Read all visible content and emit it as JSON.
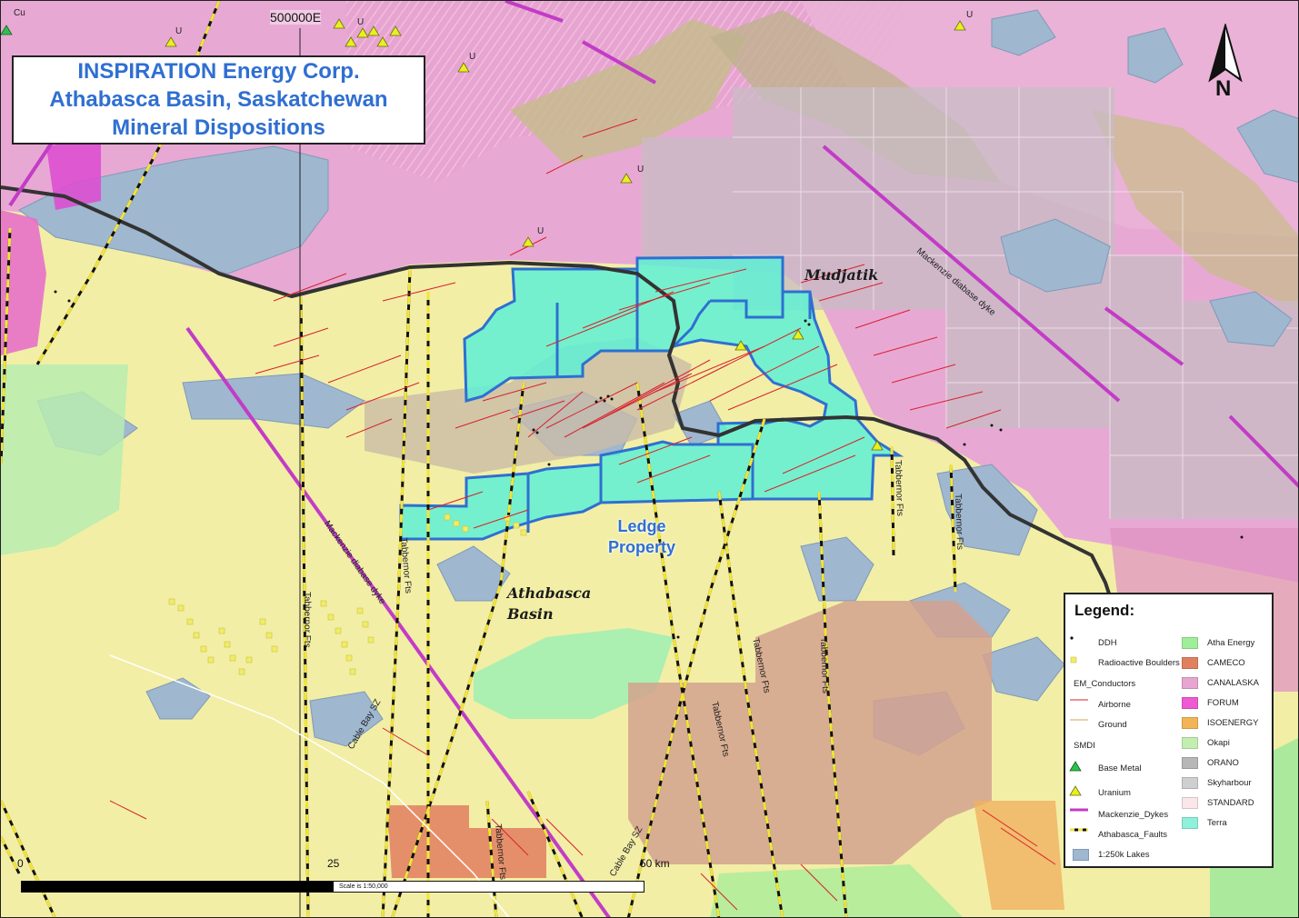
{
  "title": {
    "line1": "INSPIRATION Energy Corp.",
    "line2": "Athabasca Basin, Saskatchewan",
    "line3": "Mineral Dispositions"
  },
  "grid_label": "500000E",
  "north_label": "N",
  "labels": {
    "mudjatik": "Mudjatik",
    "athabasca_basin": "Athabasca Basin",
    "ledge_property_line1": "Ledge",
    "ledge_property_line2": "Property",
    "dyke_1": "Mackenzie diabase dyke",
    "dyke_2": "Mackenzie diabase dyke",
    "fault_tabbernor": "Tabbernor Fts",
    "fault_cable_bay": "Cable Bay SZ",
    "uranium_mark": "U",
    "cu_mark": "Cu"
  },
  "scale": {
    "ticks": [
      "0",
      "25",
      "50 km"
    ],
    "text": "Scale is 1:50,000"
  },
  "legend": {
    "title": "Legend:",
    "items_left": [
      {
        "label": "DDH",
        "symbol": "dot"
      },
      {
        "label": "Radioactive Boulders",
        "symbol": "square-yellow"
      },
      {
        "label": "EM_Conductors",
        "symbol": "header"
      },
      {
        "label": "Airborne",
        "symbol": "line-red"
      },
      {
        "label": "Ground",
        "symbol": "line-orange"
      },
      {
        "label": "SMDI",
        "symbol": "header"
      },
      {
        "label": "Base Metal",
        "symbol": "triangle-green"
      },
      {
        "label": "Uranium",
        "symbol": "triangle-yellow"
      },
      {
        "label": "Mackenzie_Dykes",
        "symbol": "line-magenta"
      },
      {
        "label": "Athabasca_Faults",
        "symbol": "line-dashed"
      },
      {
        "label": "1:250k Lakes",
        "symbol": "lake"
      }
    ],
    "items_right": [
      {
        "label": "Atha Energy",
        "color": "#9fef9a"
      },
      {
        "label": "CAMECO",
        "color": "#e0805f"
      },
      {
        "label": "CANALASKA",
        "color": "#e7a6cf"
      },
      {
        "label": "FORUM",
        "color": "#ee5ad1"
      },
      {
        "label": "ISOENERGY",
        "color": "#f3b457"
      },
      {
        "label": "Okapi",
        "color": "#c2efb0"
      },
      {
        "label": "ORANO",
        "color": "#b7b7b7"
      },
      {
        "label": "Skyharbour",
        "color": "#cfcfcf"
      },
      {
        "label": "STANDARD",
        "color": "#fbe6ea"
      },
      {
        "label": "Terra",
        "color": "#8ff0dc"
      }
    ]
  },
  "colors": {
    "basin": "#f2eea6",
    "shield_pink": "#e6a1d3",
    "lake": "#9fb7cf",
    "ledge_fill": "#5ff0d5",
    "ledge_outline": "#2f6fd1",
    "dyke": "#c23cc6",
    "fault": "#111111",
    "conductor": "#d9212b",
    "title_text": "#2f6fd1"
  }
}
